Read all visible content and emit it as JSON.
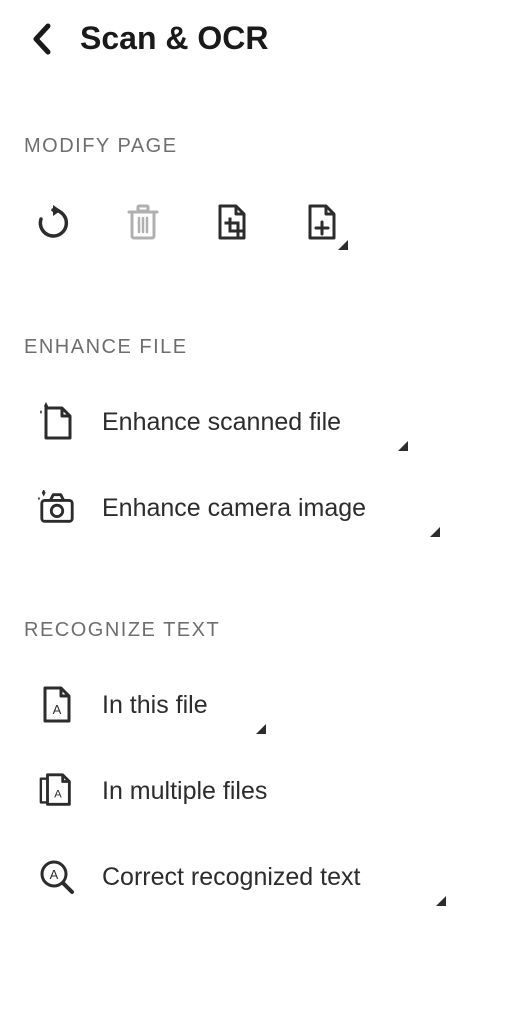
{
  "header": {
    "title": "Scan & OCR"
  },
  "sections": {
    "modify_page": {
      "label": "MODIFY PAGE"
    },
    "enhance_file": {
      "label": "ENHANCE FILE",
      "items": {
        "enhance_scanned": "Enhance scanned file",
        "enhance_camera": "Enhance camera image"
      }
    },
    "recognize_text": {
      "label": "RECOGNIZE TEXT",
      "items": {
        "in_this_file": "In this file",
        "in_multiple": "In multiple files",
        "correct": "Correct recognized text"
      }
    }
  }
}
